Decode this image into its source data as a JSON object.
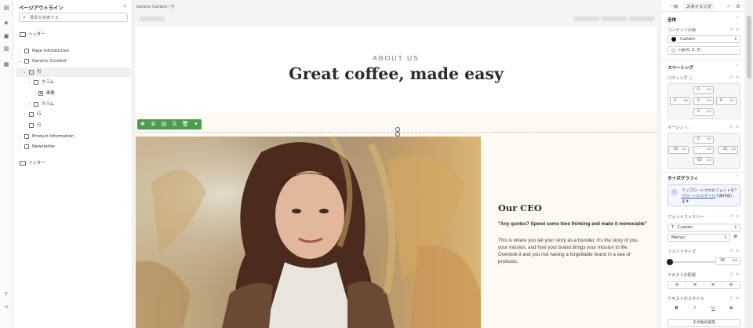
{
  "rail": {
    "icons": [
      "panel-icon",
      "layers-icon",
      "pages-icon",
      "database-icon",
      "apps-icon",
      "help-icon",
      "code-icon"
    ]
  },
  "outline": {
    "title": "ページアウトライン",
    "close_glyph": "«",
    "search_placeholder": "要素を検索する",
    "items": [
      {
        "label": "ヘッダー",
        "level": 0,
        "chevron": "",
        "icon": "header-icon"
      },
      {
        "label": "Page Introduction",
        "level": 0,
        "chevron": "›",
        "icon": "section-icon"
      },
      {
        "label": "Generic Content",
        "level": 0,
        "chevron": "⌄",
        "icon": "section-icon"
      },
      {
        "label": "行",
        "level": 1,
        "chevron": "⌄",
        "icon": "row-icon",
        "selected": true
      },
      {
        "label": "カラム",
        "level": 2,
        "chevron": "⌄",
        "icon": "column-icon"
      },
      {
        "label": "画像",
        "level": 3,
        "chevron": "",
        "icon": "image-icon"
      },
      {
        "label": "カラム",
        "level": 2,
        "chevron": "›",
        "icon": "column-icon"
      },
      {
        "label": "行",
        "level": 1,
        "chevron": "›",
        "icon": "row-icon"
      },
      {
        "label": "行",
        "level": 1,
        "chevron": "›",
        "icon": "row-icon"
      },
      {
        "label": "Product Information",
        "level": 0,
        "chevron": "›",
        "icon": "section-icon"
      },
      {
        "label": "Newsletter",
        "level": 0,
        "chevron": "›",
        "icon": "section-icon"
      },
      {
        "label": "フッター",
        "level": 0,
        "chevron": "",
        "icon": "footer-icon"
      }
    ]
  },
  "canvas": {
    "breadcrumb": "Generic Content  /  行",
    "about_label": "ABOUT US",
    "headline": "Great coffee, made easy",
    "ceo_title": "Our CEO",
    "ceo_quote": "\"Any quotes? Spend some time thinking and make it memorable\"",
    "ceo_body": "This is where you tell your story as a founder. It's the story of you, your mission, and how your brand brings your mission to life. Overlook it and you risk having a forgettable brand in a sea of products.",
    "toolbar_icons": [
      "move-icon",
      "duplicate-icon",
      "save-icon",
      "copy-icon",
      "delete-icon",
      "more-icon"
    ],
    "toolbar_glyphs": [
      "✥",
      "⧉",
      "▤",
      "⎘",
      "🗑",
      "▾"
    ]
  },
  "rpanel": {
    "tabs": [
      "一般",
      "スタイリング"
    ],
    "active_tab": 1,
    "section_all": "全体",
    "content_color_label": "コンテンツの色",
    "content_color_value": "Custom",
    "content_color_hex": "#111111",
    "color_input_value": "rgb(0, 0, 0)",
    "spacing_section": "スペーシング",
    "padding_label": "パディング ⓘ",
    "padding": {
      "top": "0",
      "left": "0",
      "inner_left": "0",
      "inner_right": "0",
      "right": "0",
      "bottom": "0",
      "unit": "px"
    },
    "margin_label": "マージン ⓘ",
    "margin": {
      "top": "0",
      "left": "-15",
      "inner_left": "--",
      "inner_right": "--",
      "right": "-15",
      "bottom": "65",
      "unit": "px"
    },
    "typography_section": "タイポグラフィ",
    "notice_text_1": "アップロードされたフォントを",
    "notice_link": "グローバルスタイル",
    "notice_text_2": "で再作成します",
    "font_family_label": "フォントファミリー",
    "font_family_value": "Custom",
    "font_name_value": "Meiryo",
    "font_size_label": "フォントサイズ",
    "font_size_value": "16",
    "font_size_unit": "px",
    "font_size_fraction": 0.05,
    "text_align_label": "テキストの配置",
    "align_glyphs": [
      "≡",
      "≡",
      "≡",
      "≡"
    ],
    "text_style_label": "テキストのスタイル",
    "style_glyphs": [
      "B",
      "I",
      "U",
      "S"
    ],
    "more_button": "その他の設定"
  }
}
